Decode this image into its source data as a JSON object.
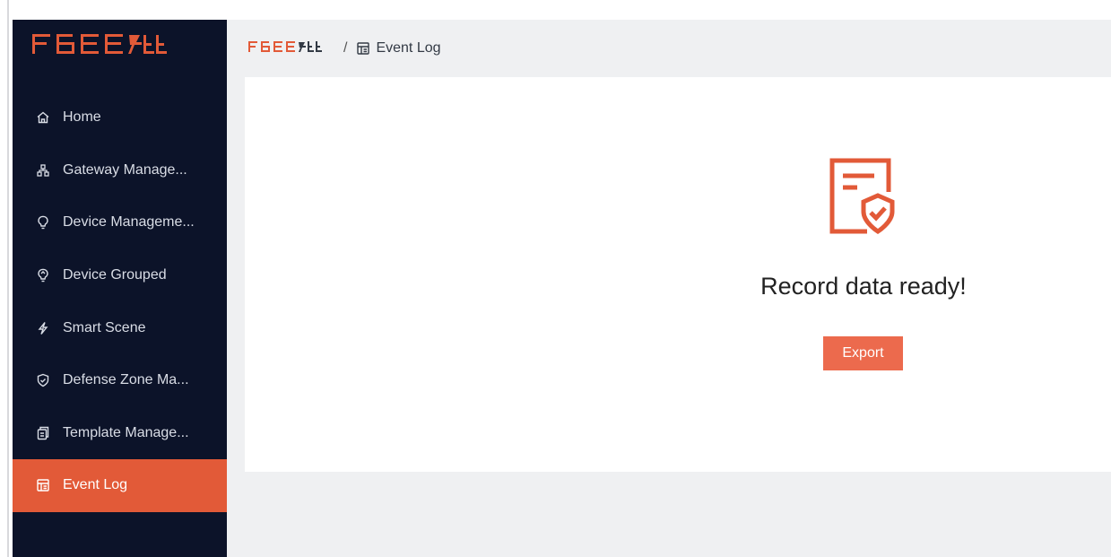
{
  "app": {
    "logo_text": "FBEE飞比"
  },
  "sidebar": {
    "items": [
      {
        "label": "Home",
        "icon": "home-icon",
        "active": false
      },
      {
        "label": "Gateway Manage...",
        "icon": "network-icon",
        "active": false
      },
      {
        "label": "Device Manageme...",
        "icon": "lightbulb-icon",
        "active": false
      },
      {
        "label": "Device Grouped",
        "icon": "group-bulb-icon",
        "active": false
      },
      {
        "label": "Smart Scene",
        "icon": "lightning-icon",
        "active": false
      },
      {
        "label": "Defense Zone Ma...",
        "icon": "shield-check-icon",
        "active": false
      },
      {
        "label": "Template Manage...",
        "icon": "template-icon",
        "active": false
      },
      {
        "label": "Event Log",
        "icon": "event-log-icon",
        "active": true
      }
    ]
  },
  "breadcrumb": {
    "root": "FBEE飞比",
    "separator": "/",
    "current": "Event Log"
  },
  "main": {
    "message": "Record data ready!",
    "export_label": "Export"
  },
  "colors": {
    "sidebar_bg": "#0c1329",
    "accent": "#e25a38",
    "button": "#ec6a4d",
    "content_bg": "#eff0f2"
  }
}
